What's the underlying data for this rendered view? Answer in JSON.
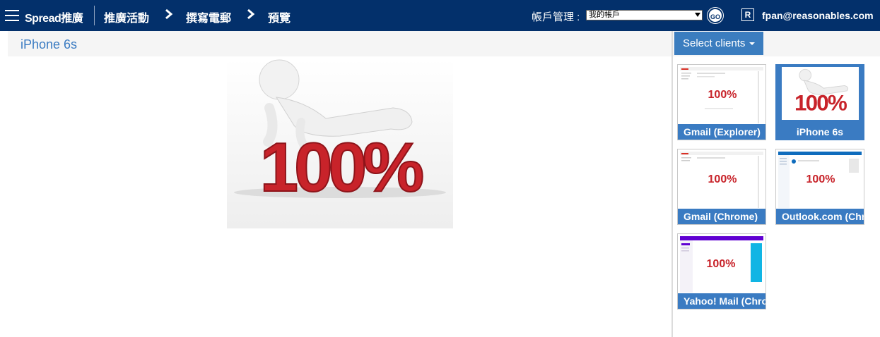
{
  "nav": {
    "brand": "Spread推廣",
    "crumbs": [
      "推廣活動",
      "撰寫電郵",
      "預覽"
    ],
    "account_label": "帳戶管理 :",
    "account_selected": "我的帳戶",
    "go_label": "GO",
    "user_initial": "R",
    "user_email": "fpan@reasonables.com"
  },
  "main": {
    "title": "iPhone 6s",
    "hero_text": "100%"
  },
  "panel": {
    "select_clients_label": "Select clients",
    "clients": [
      {
        "label": "Gmail (Explorer)",
        "active": false
      },
      {
        "label": "iPhone 6s",
        "active": true
      },
      {
        "label": "Gmail (Chrome)",
        "active": false
      },
      {
        "label": "Outlook.com (Chrome)",
        "active": false
      },
      {
        "label": "Yahoo! Mail (Chrome)",
        "active": false
      }
    ]
  },
  "colors": {
    "nav_bg": "#03306b",
    "accent": "#3a7bc2",
    "hero_red": "#c8232a"
  }
}
